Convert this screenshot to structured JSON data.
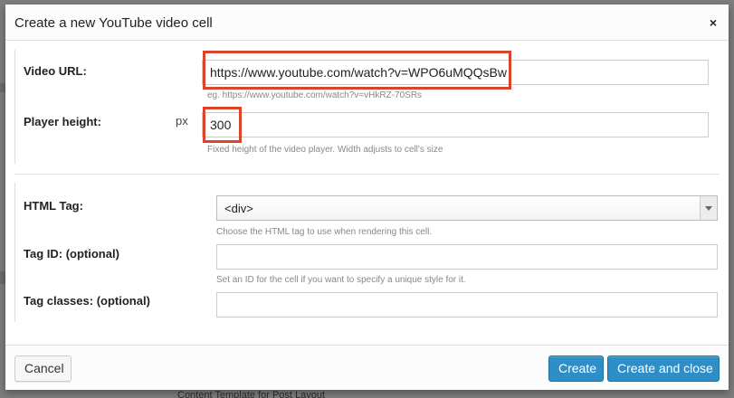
{
  "dialog": {
    "title": "Create a new YouTube video cell",
    "close_label": "×"
  },
  "fields": {
    "video_url": {
      "label": "Video URL:",
      "value": "https://www.youtube.com/watch?v=WPO6uMQQsBw",
      "help": "eg. https://www.youtube.com/watch?v=vHkRZ-70SRs"
    },
    "player_height": {
      "label": "Player height:",
      "unit": "px",
      "value": "300",
      "help": "Fixed height of the video player. Width adjusts to cell's size"
    },
    "html_tag": {
      "label": "HTML Tag:",
      "selected": "<div>",
      "help": "Choose the HTML tag to use when rendering this cell."
    },
    "tag_id": {
      "label": "Tag ID: (optional)",
      "value": "",
      "help": "Set an ID for the cell if you want to specify a unique style for it."
    },
    "tag_classes": {
      "label": "Tag classes: (optional)",
      "value": ""
    }
  },
  "footer": {
    "cancel_label": "Cancel",
    "create_label": "Create",
    "create_close_label": "Create and close"
  },
  "background": {
    "fragment_text": "Content Template for Post Layout"
  },
  "colors": {
    "highlight": "#d9442a",
    "primary_button": "#2e8ec7"
  }
}
